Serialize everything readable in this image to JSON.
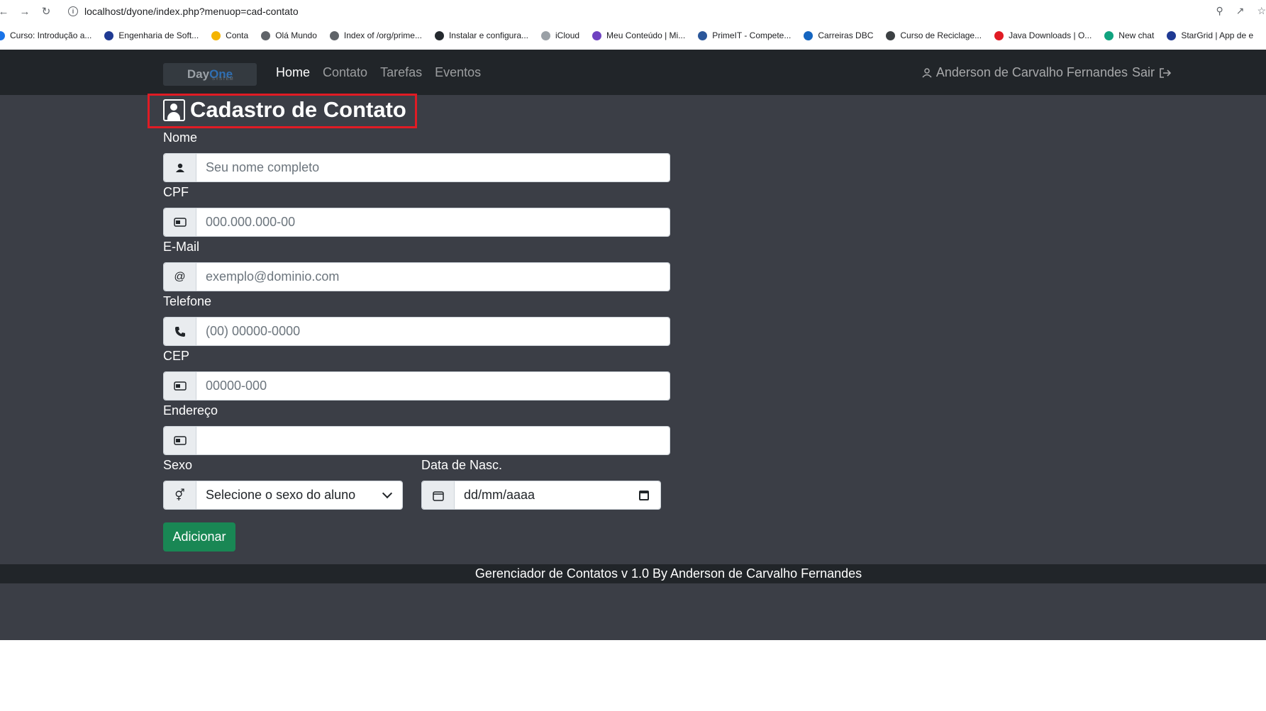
{
  "browser": {
    "url": "localhost/dyone/index.php?menuop=cad-contato",
    "bookmarks": [
      {
        "label": "Curso: Introdução a...",
        "color": "#1a73e8"
      },
      {
        "label": "Engenharia de Soft...",
        "color": "#1f3a93"
      },
      {
        "label": "Conta",
        "color": "#f4b400"
      },
      {
        "label": "Olá Mundo",
        "color": "#5f6368"
      },
      {
        "label": "Index of /org/prime...",
        "color": "#5f6368"
      },
      {
        "label": "Instalar e configura...",
        "color": "#24292e"
      },
      {
        "label": "iCloud",
        "color": "#9aa0a6"
      },
      {
        "label": "Meu Conteúdo | Mi...",
        "color": "#6f42c1"
      },
      {
        "label": "PrimeIT - Compete...",
        "color": "#2b579a"
      },
      {
        "label": "Carreiras DBC",
        "color": "#1565c0"
      },
      {
        "label": "Curso de Reciclage...",
        "color": "#3c4043"
      },
      {
        "label": "Java Downloads | O...",
        "color": "#e01b24"
      },
      {
        "label": "New chat",
        "color": "#10a37f"
      },
      {
        "label": "StarGrid | App de e",
        "color": "#1f3a93"
      }
    ]
  },
  "navbar": {
    "logo_day": "Day",
    "logo_one": "One",
    "logo_system": "SYSTEM",
    "menu": [
      "Home",
      "Contato",
      "Tarefas",
      "Eventos"
    ],
    "user": "Anderson de Carvalho Fernandes",
    "logout": "Sair"
  },
  "form": {
    "title": "Cadastro de Contato",
    "nome_label": "Nome",
    "nome_placeholder": "Seu nome completo",
    "cpf_label": "CPF",
    "cpf_placeholder": "000.000.000-00",
    "email_label": "E-Mail",
    "email_placeholder": "exemplo@dominio.com",
    "email_addon": "@",
    "telefone_label": "Telefone",
    "telefone_placeholder": "(00) 00000-0000",
    "cep_label": "CEP",
    "cep_placeholder": "00000-000",
    "endereco_label": "Endereço",
    "endereco_value": "",
    "sexo_label": "Sexo",
    "sexo_selected": "Selecione o sexo do aluno",
    "data_label": "Data de Nasc.",
    "data_placeholder": "dd/mm/aaaa",
    "submit": "Adicionar"
  },
  "footer": {
    "text": "Gerenciador de Contatos v 1.0 By Anderson de Carvalho Fernandes"
  }
}
